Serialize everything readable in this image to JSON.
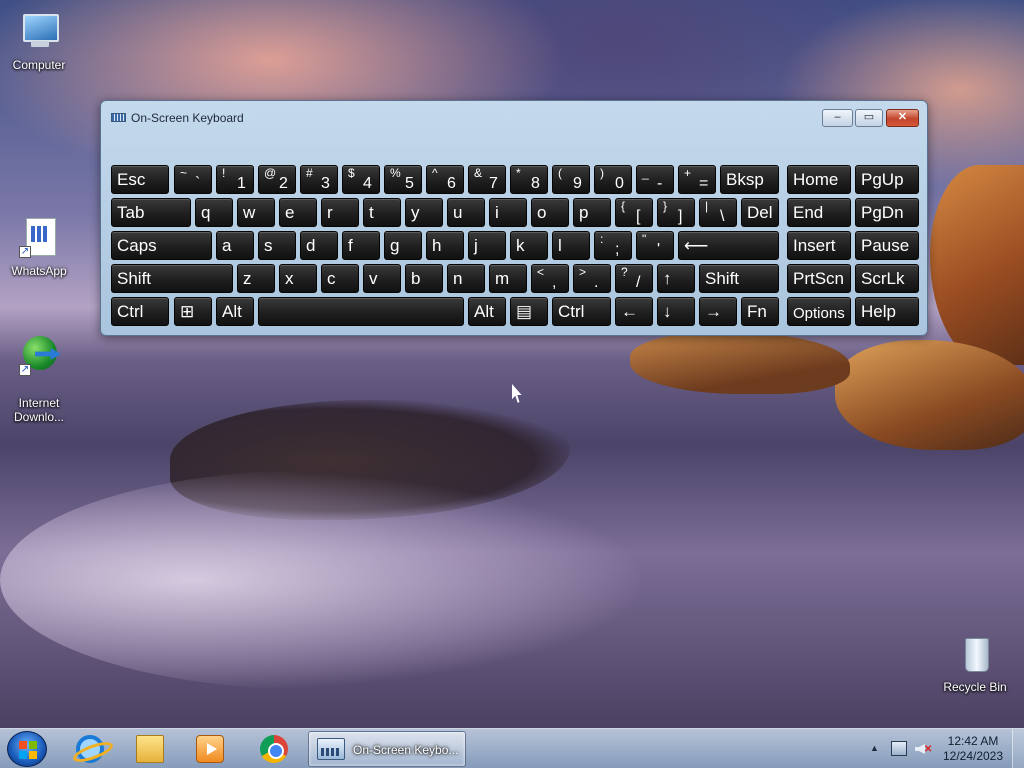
{
  "desktop": {
    "icons": [
      {
        "label": "Computer",
        "icon": "computer-icon"
      },
      {
        "label": "WhatsApp",
        "icon": "document-shortcut-icon"
      },
      {
        "label": "Internet\nDownlo...",
        "icon": "internet-download-manager-icon"
      },
      {
        "label": "Recycle Bin",
        "icon": "recycle-bin-icon"
      }
    ]
  },
  "osk": {
    "title": "On-Screen Keyboard",
    "controls": {
      "minimize": "–",
      "maximize": "▭",
      "close": "✕"
    },
    "rows": [
      [
        {
          "label": "Esc"
        },
        {
          "sup": "~",
          "main": "`"
        },
        {
          "sup": "!",
          "main": "1"
        },
        {
          "sup": "@",
          "main": "2"
        },
        {
          "sup": "#",
          "main": "3"
        },
        {
          "sup": "$",
          "main": "4"
        },
        {
          "sup": "%",
          "main": "5"
        },
        {
          "sup": "^",
          "main": "6"
        },
        {
          "sup": "&",
          "main": "7"
        },
        {
          "sup": "*",
          "main": "8"
        },
        {
          "sup": "(",
          "main": "9"
        },
        {
          "sup": ")",
          "main": "0"
        },
        {
          "sup": "_",
          "main": "-"
        },
        {
          "sup": "+",
          "main": "="
        },
        {
          "label": "Bksp"
        },
        {
          "label": "Home"
        },
        {
          "label": "PgUp"
        }
      ],
      [
        {
          "label": "Tab"
        },
        {
          "label": "q"
        },
        {
          "label": "w"
        },
        {
          "label": "e"
        },
        {
          "label": "r"
        },
        {
          "label": "t"
        },
        {
          "label": "y"
        },
        {
          "label": "u"
        },
        {
          "label": "i"
        },
        {
          "label": "o"
        },
        {
          "label": "p"
        },
        {
          "sup": "{",
          "main": "["
        },
        {
          "sup": "}",
          "main": "]"
        },
        {
          "sup": "|",
          "main": "\\"
        },
        {
          "label": "Del"
        },
        {
          "label": "End"
        },
        {
          "label": "PgDn"
        }
      ],
      [
        {
          "label": "Caps"
        },
        {
          "label": "a"
        },
        {
          "label": "s"
        },
        {
          "label": "d"
        },
        {
          "label": "f"
        },
        {
          "label": "g"
        },
        {
          "label": "h"
        },
        {
          "label": "j"
        },
        {
          "label": "k"
        },
        {
          "label": "l"
        },
        {
          "sup": ":",
          "main": ";"
        },
        {
          "sup": "\"",
          "main": "'"
        },
        {
          "label": "⟵"
        },
        {
          "label": "Insert"
        },
        {
          "label": "Pause"
        }
      ],
      [
        {
          "label": "Shift"
        },
        {
          "label": "z"
        },
        {
          "label": "x"
        },
        {
          "label": "c"
        },
        {
          "label": "v"
        },
        {
          "label": "b"
        },
        {
          "label": "n"
        },
        {
          "label": "m"
        },
        {
          "sup": "<",
          "main": ","
        },
        {
          "sup": ">",
          "main": "."
        },
        {
          "sup": "?",
          "main": "/"
        },
        {
          "label": "↑"
        },
        {
          "label": "Shift"
        },
        {
          "label": "PrtScn"
        },
        {
          "label": "ScrLk"
        }
      ],
      [
        {
          "label": "Ctrl"
        },
        {
          "label": "⊞"
        },
        {
          "label": "Alt"
        },
        {
          "label": ""
        },
        {
          "label": "Alt"
        },
        {
          "label": "▤"
        },
        {
          "label": "Ctrl"
        },
        {
          "label": "←"
        },
        {
          "label": "↓"
        },
        {
          "label": "→"
        },
        {
          "label": "Fn"
        },
        {
          "label": "Options"
        },
        {
          "label": "Help"
        }
      ]
    ]
  },
  "taskbar": {
    "pinned": [
      {
        "name": "internet-explorer",
        "icon": "internet-explorer-icon"
      },
      {
        "name": "windows-explorer",
        "icon": "folder-icon"
      },
      {
        "name": "media-player",
        "icon": "media-player-icon"
      },
      {
        "name": "chrome",
        "icon": "chrome-icon"
      }
    ],
    "active_task": "On-Screen Keybo...",
    "clock": {
      "time": "12:42 AM",
      "date": "12/24/2023"
    }
  }
}
